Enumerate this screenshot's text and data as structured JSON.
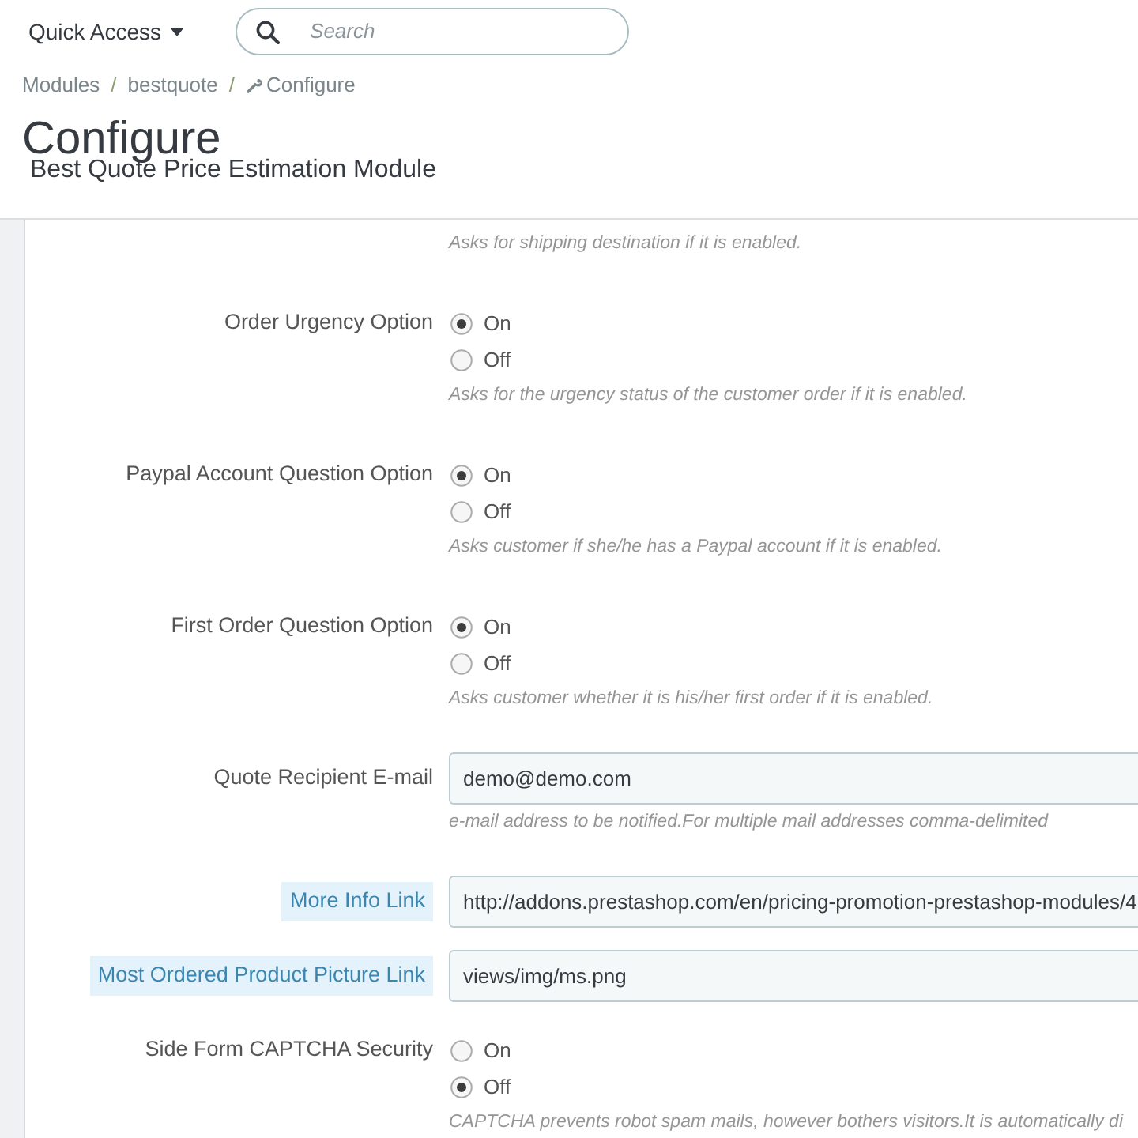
{
  "header": {
    "quick_access": "Quick Access",
    "search": {
      "placeholder": "Search"
    }
  },
  "breadcrumb": [
    {
      "kind": "link",
      "text": "Modules"
    },
    {
      "kind": "separator",
      "text": "/"
    },
    {
      "kind": "link",
      "text": "bestquote"
    },
    {
      "kind": "separator",
      "text": "/"
    },
    {
      "kind": "current",
      "text": "Configure"
    }
  ],
  "page_title": "Configure",
  "page_subtitle": "Best Quote Price Estimation Module",
  "form": {
    "rows": [
      {
        "kind": "help",
        "help": "Asks for shipping destination if it is enabled."
      },
      {
        "kind": "radio",
        "label": "Order Urgency Option",
        "tooltip": false,
        "options": [
          {
            "label": "On",
            "selected": true
          },
          {
            "label": "Off",
            "selected": false
          }
        ],
        "help": "Asks for the urgency status of the customer order if it is enabled."
      },
      {
        "kind": "radio",
        "label": "Paypal Account Question Option",
        "tooltip": false,
        "options": [
          {
            "label": "On",
            "selected": true
          },
          {
            "label": "Off",
            "selected": false
          }
        ],
        "help": "Asks customer if she/he has a Paypal account if it is enabled."
      },
      {
        "kind": "radio",
        "label": "First Order Question Option",
        "tooltip": false,
        "options": [
          {
            "label": "On",
            "selected": true
          },
          {
            "label": "Off",
            "selected": false
          }
        ],
        "help": "Asks customer whether it is his/her first order if it is enabled."
      },
      {
        "kind": "text",
        "label": "Quote Recipient E-mail",
        "tooltip": false,
        "value": "demo@demo.com",
        "help": "e-mail address to be notified.For multiple mail addresses comma-delimited"
      },
      {
        "kind": "text",
        "label": "More Info Link",
        "tooltip": true,
        "value": "http://addons.prestashop.com/en/pricing-promotion-prestashop-modules/4"
      },
      {
        "kind": "text",
        "label": "Most Ordered Product Picture Link",
        "tooltip": true,
        "value": "views/img/ms.png"
      },
      {
        "kind": "radio",
        "label": "Side Form CAPTCHA Security",
        "tooltip": false,
        "options": [
          {
            "label": "On",
            "selected": false
          },
          {
            "label": "Off",
            "selected": true
          }
        ],
        "help": "CAPTCHA prevents robot spam mails, however bothers visitors.It is automatically di"
      }
    ]
  }
}
